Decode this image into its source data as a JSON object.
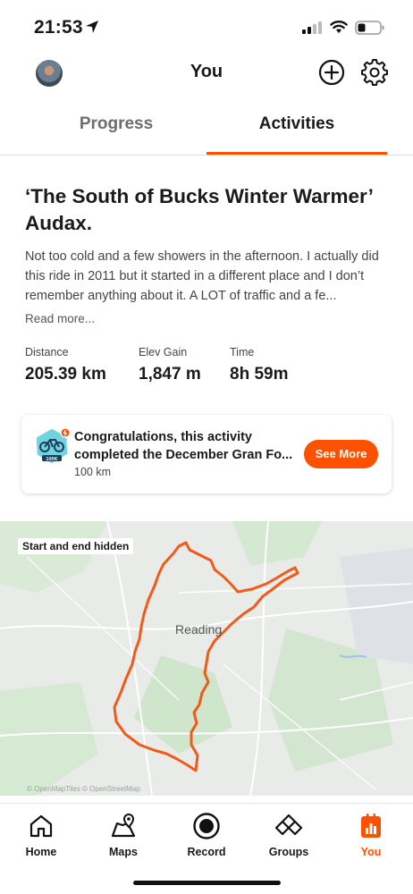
{
  "status_bar": {
    "time": "21:53"
  },
  "header": {
    "title": "You"
  },
  "tabs": [
    {
      "label": "Progress",
      "active": false
    },
    {
      "label": "Activities",
      "active": true
    }
  ],
  "activity": {
    "title": "‘The South of Bucks Winter Warmer’ Audax.",
    "description": "Not too cold and a few showers in the afternoon. I actually did this ride in 2011 but it started in a different place and I don’t remember anything about it. A LOT of traffic and a fe...",
    "read_more": "Read more...",
    "stats": [
      {
        "label": "Distance",
        "value": "205.39 km"
      },
      {
        "label": "Elev Gain",
        "value": "1,847 m"
      },
      {
        "label": "Time",
        "value": "8h 59m"
      }
    ]
  },
  "challenge": {
    "line1": "Congratulations, this activity",
    "line2": "completed the December Gran Fo...",
    "subtitle": "100 km",
    "badge_text": "100K",
    "button": "See More"
  },
  "map": {
    "tag": "Start and end hidden",
    "place": "Reading",
    "credit": "© OpenMapTiles © OpenStreetMap"
  },
  "bottom_nav": [
    {
      "label": "Home",
      "icon": "home-icon"
    },
    {
      "label": "Maps",
      "icon": "maps-icon"
    },
    {
      "label": "Record",
      "icon": "record-icon"
    },
    {
      "label": "Groups",
      "icon": "groups-icon"
    },
    {
      "label": "You",
      "icon": "you-icon",
      "active": true
    }
  ],
  "colors": {
    "accent": "#fc5200",
    "text": "#1a1a1a",
    "muted": "#6d6d72",
    "route": "#f05a1a"
  }
}
